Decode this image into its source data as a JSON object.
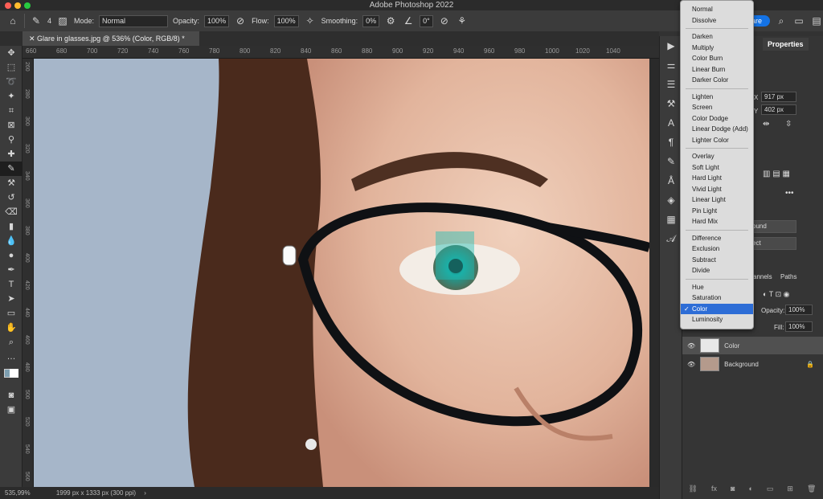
{
  "window": {
    "title": "Adobe Photoshop 2022"
  },
  "options": {
    "mode_label": "Mode:",
    "mode_value": "Normal",
    "opacity_label": "Opacity:",
    "opacity_value": "100%",
    "flow_label": "Flow:",
    "flow_value": "100%",
    "smoothing_label": "Smoothing:",
    "smoothing_value": "0%",
    "angle_value": "0°",
    "brush_size": "4",
    "share_label": "Share"
  },
  "document": {
    "tab_title": "Glare in glasses.jpg @ 536% (Color, RGB/8) *"
  },
  "ruler": {
    "h": [
      "660",
      "680",
      "700",
      "720",
      "740",
      "760",
      "780",
      "800",
      "820",
      "840",
      "860",
      "880",
      "900",
      "920",
      "940",
      "960",
      "980",
      "1000",
      "1020",
      "1040"
    ],
    "v": [
      "260",
      "280",
      "300",
      "320",
      "340",
      "360",
      "380",
      "400",
      "420",
      "440",
      "460",
      "480",
      "500",
      "520",
      "540",
      "560"
    ]
  },
  "status": {
    "zoom": "535,99%",
    "info": "1999 px x 1333 px (300 ppi)"
  },
  "properties": {
    "tab_label": "Properties",
    "partial_tab": "u",
    "x_value": "917 px",
    "y_value": "402 px",
    "x_label": "X",
    "y_label": "Y",
    "btn1": "ound",
    "btn2": "ect"
  },
  "layers_panel": {
    "channels_tab": "annels",
    "paths_tab": "Paths",
    "opacity_label": "Opacity:",
    "opacity_value": "100%",
    "fill_label": "Fill:",
    "fill_value": "100%",
    "layers": [
      {
        "name": "Color"
      },
      {
        "name": "Background"
      }
    ]
  },
  "blend_menu": {
    "groups": [
      [
        "Normal",
        "Dissolve"
      ],
      [
        "Darken",
        "Multiply",
        "Color Burn",
        "Linear Burn",
        "Darker Color"
      ],
      [
        "Lighten",
        "Screen",
        "Color Dodge",
        "Linear Dodge (Add)",
        "Lighter Color"
      ],
      [
        "Overlay",
        "Soft Light",
        "Hard Light",
        "Vivid Light",
        "Linear Light",
        "Pin Light",
        "Hard Mix"
      ],
      [
        "Difference",
        "Exclusion",
        "Subtract",
        "Divide"
      ],
      [
        "Hue",
        "Saturation",
        "Color",
        "Luminosity"
      ]
    ],
    "selected": "Color"
  },
  "colors": {
    "accent": "#1473e6",
    "menu_highlight": "#2d6dd6"
  }
}
